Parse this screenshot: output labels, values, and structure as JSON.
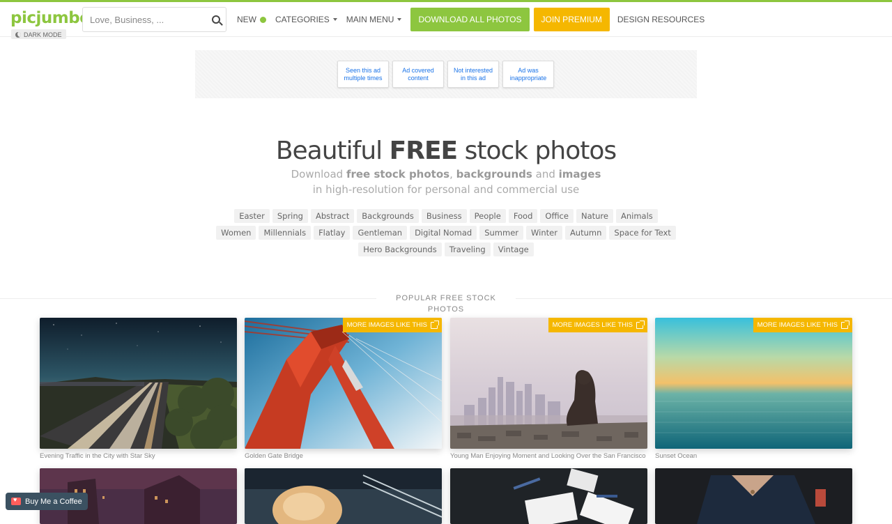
{
  "brand": {
    "logo_text": "picjumbo",
    "accent": "#8dc63f",
    "premium_color": "#f5b700"
  },
  "dark_mode": {
    "label": "DARK MODE",
    "icon": "moon-icon"
  },
  "search": {
    "placeholder": "Love, Business, ...",
    "icon": "search-icon"
  },
  "nav": {
    "new_label": "NEW",
    "categories_label": "CATEGORIES",
    "main_menu_label": "MAIN MENU",
    "download_all_label": "DOWNLOAD ALL PHOTOS",
    "join_premium_label": "JOIN PREMIUM",
    "design_resources_label": "DESIGN RESOURCES"
  },
  "ad_feedback": [
    {
      "label": "Seen this ad multiple times"
    },
    {
      "label": "Ad covered content"
    },
    {
      "label": "Not interested in this ad"
    },
    {
      "label": "Ad was inappropriate"
    }
  ],
  "hero": {
    "title_pre": "Beautiful",
    "title_bold": "FREE",
    "title_post": "stock photos",
    "sub_1": "Download",
    "sub_b1": "free stock photos",
    "sub_2": ",",
    "sub_b2": "backgrounds",
    "sub_3": "and",
    "sub_b3": "images",
    "sub_line2": "in high-resolution for personal and commercial use"
  },
  "tags": [
    [
      "Easter",
      "Spring",
      "Abstract",
      "Backgrounds",
      "Business",
      "People",
      "Food",
      "Office",
      "Nature",
      "Animals"
    ],
    [
      "Women",
      "Millennials",
      "Flatlay",
      "Gentleman",
      "Digital Nomad",
      "Summer",
      "Winter",
      "Autumn",
      "Space for Text"
    ],
    [
      "Hero Backgrounds",
      "Traveling",
      "Vintage"
    ]
  ],
  "popular_heading": "POPULAR FREE STOCK PHOTOS",
  "more_images_label": "MORE IMAGES LIKE THIS",
  "photos": [
    {
      "caption": "Evening Traffic in the City with Star Sky",
      "more": false
    },
    {
      "caption": "Golden Gate Bridge",
      "more": true
    },
    {
      "caption": "Young Man Enjoying Moment and Looking Over the San Francisco",
      "more": true
    },
    {
      "caption": "Sunset Ocean",
      "more": true
    }
  ],
  "coffee": {
    "label": "Buy Me a Coffee"
  }
}
